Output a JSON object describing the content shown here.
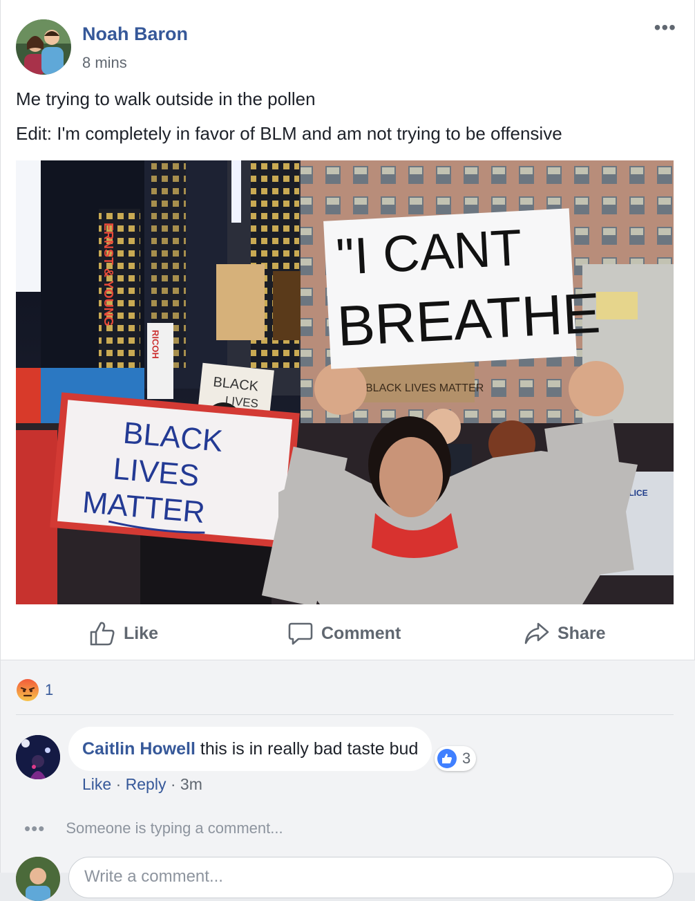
{
  "post": {
    "author": "Noah Baron",
    "time": "8 mins",
    "more_label": "•••",
    "text_line1": "Me trying to walk outside in the pollen",
    "text_line2": "Edit: I'm completely in favor of BLM and am not trying to be offensive",
    "photo": {
      "sign_main_line1": "\"I CANT",
      "sign_main_line2": "BREATHE",
      "sign_left_line1": "BLACK",
      "sign_left_line2": "LIVES",
      "sign_left_line3": "MATTER",
      "sign_back": "BLACK LIVES MATTER",
      "sign_mid_line1": "BLACK",
      "sign_mid_line2": "LIVES",
      "building_sign": "ERNST & YOUNG",
      "bank_sign": "RICOH",
      "police": "POLICE"
    }
  },
  "actions": {
    "like": "Like",
    "comment": "Comment",
    "share": "Share"
  },
  "reactions": {
    "count": "1",
    "icon": "angry-emoji"
  },
  "comment": {
    "author": "Caitlin Howell",
    "text": "this is in really bad taste bud",
    "likes": "3",
    "like_link": "Like",
    "reply_link": "Reply",
    "sep": "·",
    "time": "3m"
  },
  "typing": {
    "dots": "•••",
    "text": "Someone is typing a comment..."
  },
  "composer": {
    "placeholder": "Write a comment..."
  },
  "colors": {
    "link_blue": "#365899",
    "text": "#1d2129",
    "muted": "#606770",
    "like_blue": "#4080ff"
  }
}
